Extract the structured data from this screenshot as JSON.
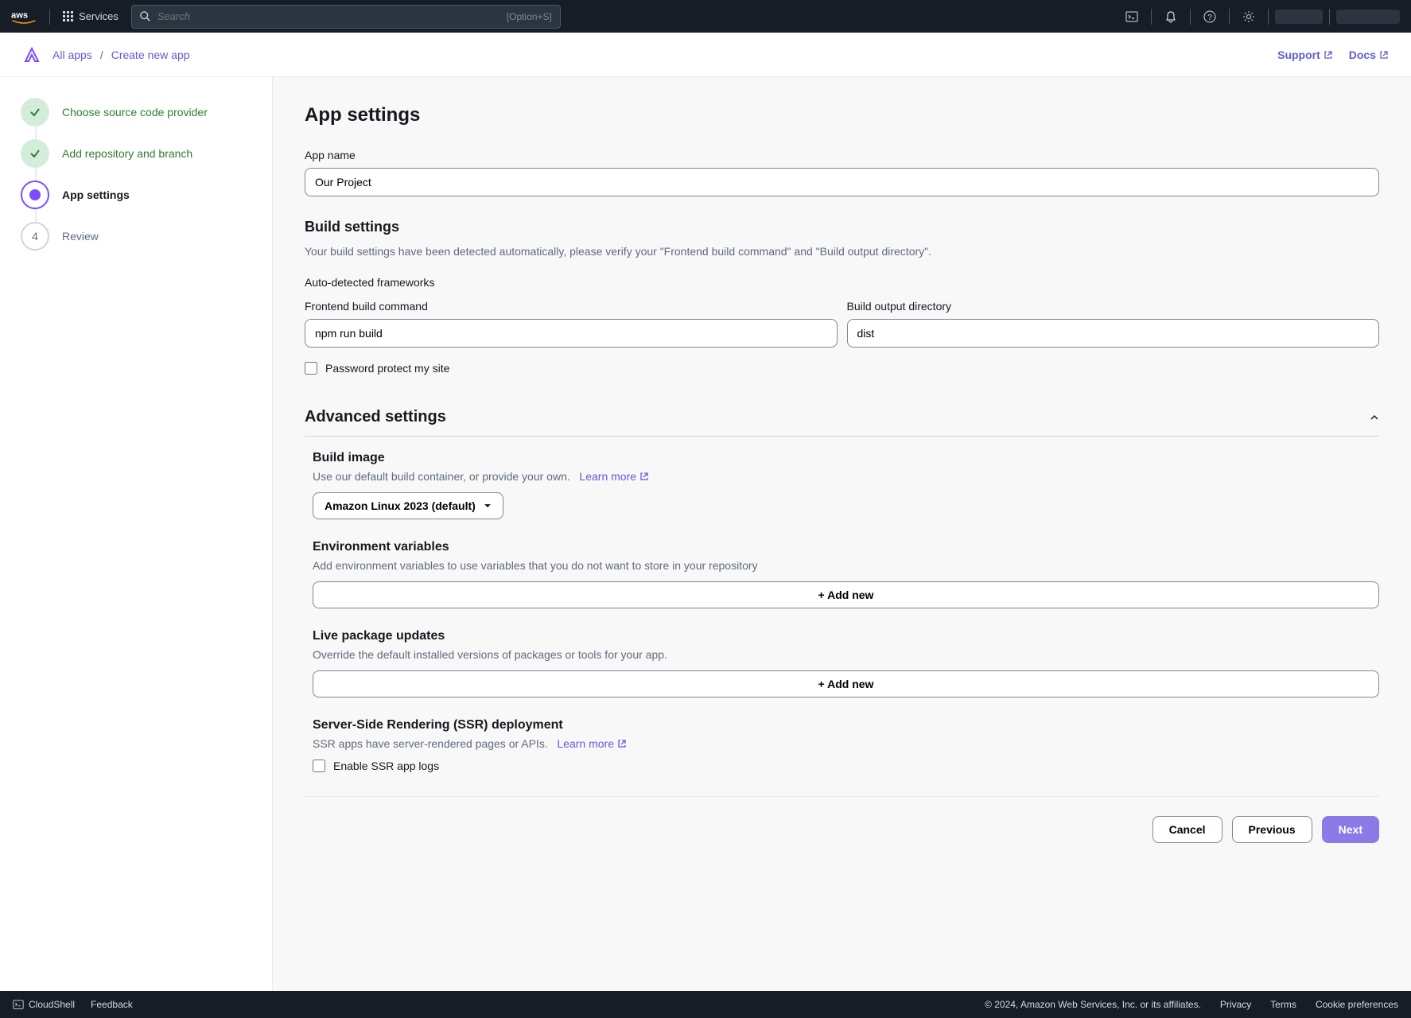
{
  "nav": {
    "services": "Services",
    "search_placeholder": "Search",
    "search_hint": "[Option+S]"
  },
  "breadcrumb": {
    "all_apps": "All apps",
    "create": "Create new app",
    "support": "Support",
    "docs": "Docs"
  },
  "steps": {
    "s1": "Choose source code provider",
    "s2": "Add repository and branch",
    "s3": "App settings",
    "s4": "Review",
    "s4_num": "4"
  },
  "page": {
    "title": "App settings",
    "app_name_label": "App name",
    "app_name_value": "Our Project"
  },
  "build": {
    "title": "Build settings",
    "desc": "Your build settings have been detected automatically, please verify your \"Frontend build command\" and \"Build output directory\".",
    "auto_detect_label": "Auto-detected frameworks",
    "frontend_cmd_label": "Frontend build command",
    "frontend_cmd_value": "npm run build",
    "output_dir_label": "Build output directory",
    "output_dir_value": "dist",
    "password_protect": "Password protect my site"
  },
  "advanced": {
    "title": "Advanced settings",
    "build_image": {
      "title": "Build image",
      "desc": "Use our default build container, or provide your own.",
      "learn_more": "Learn more",
      "selected": "Amazon Linux 2023 (default)"
    },
    "env": {
      "title": "Environment variables",
      "desc": "Add environment variables to use variables that you do not want to store in your repository",
      "add": "+ Add new"
    },
    "live": {
      "title": "Live package updates",
      "desc": "Override the default installed versions of packages or tools for your app.",
      "add": "+ Add new"
    },
    "ssr": {
      "title": "Server-Side Rendering (SSR) deployment",
      "desc": "SSR apps have server-rendered pages or APIs.",
      "learn_more": "Learn more",
      "enable_logs": "Enable SSR app logs"
    }
  },
  "actions": {
    "cancel": "Cancel",
    "previous": "Previous",
    "next": "Next"
  },
  "footer": {
    "cloudshell": "CloudShell",
    "feedback": "Feedback",
    "copyright": "© 2024, Amazon Web Services, Inc. or its affiliates.",
    "privacy": "Privacy",
    "terms": "Terms",
    "cookie": "Cookie preferences"
  }
}
